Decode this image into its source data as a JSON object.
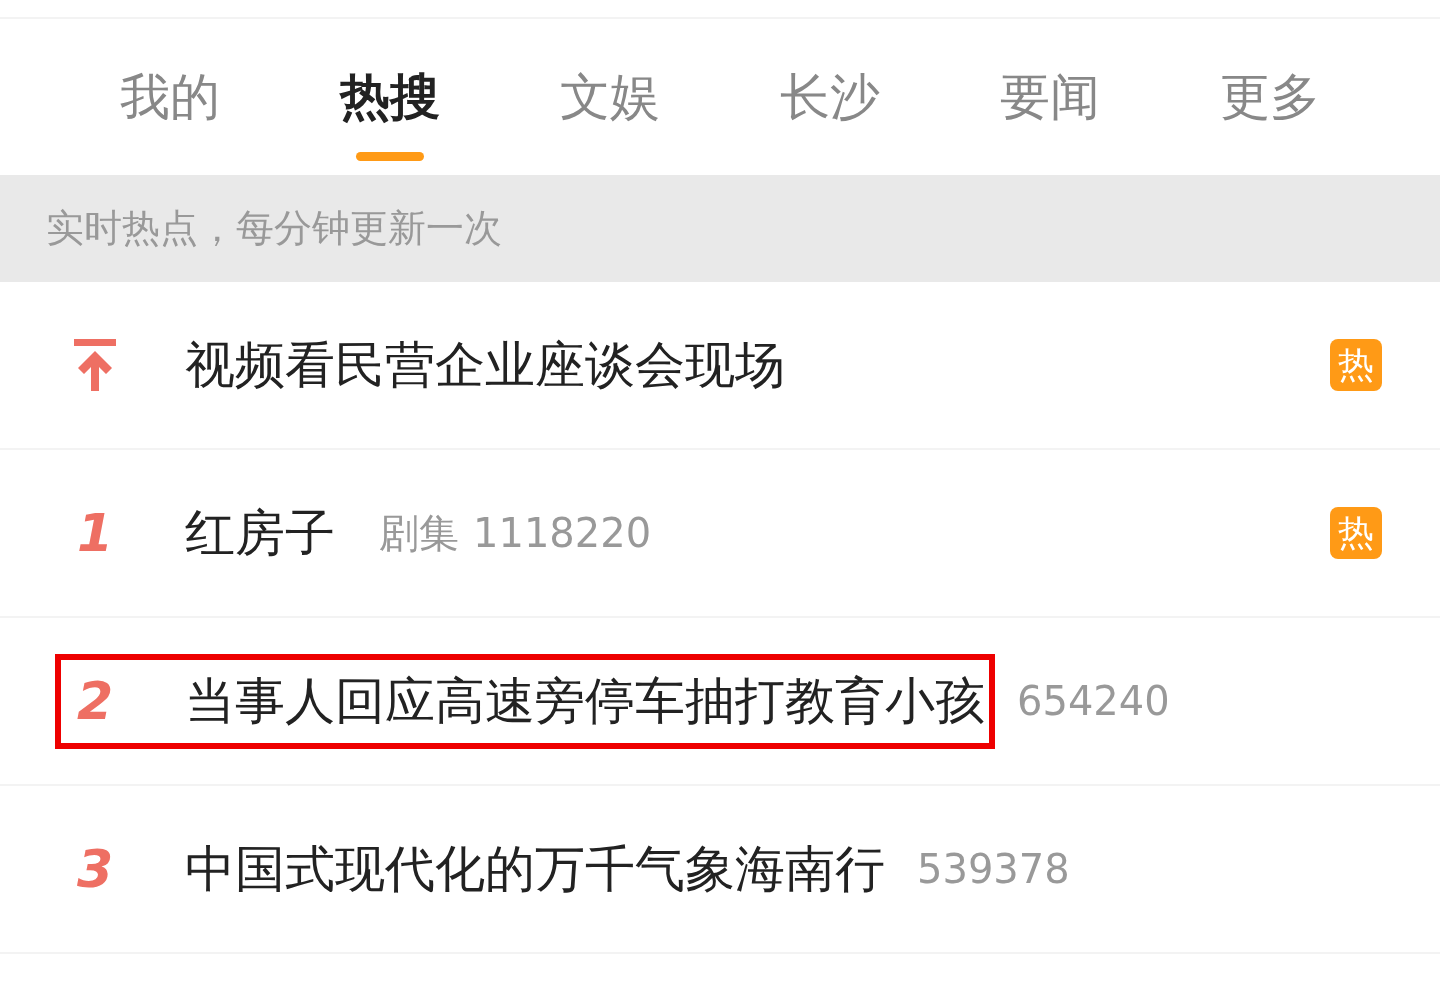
{
  "tabs": [
    {
      "label": "我的",
      "selected": false
    },
    {
      "label": "热搜",
      "selected": true
    },
    {
      "label": "文娱",
      "selected": false
    },
    {
      "label": "长沙",
      "selected": false
    },
    {
      "label": "要闻",
      "selected": false
    },
    {
      "label": "更多",
      "selected": false
    }
  ],
  "banner": "实时热点，每分钟更新一次",
  "rows": [
    {
      "kind": "pinned",
      "title": "视频看民营企业座谈会现场",
      "badge": "热",
      "highlighted": false
    },
    {
      "kind": "ranked",
      "rank": "1",
      "title": "红房子",
      "tag": "剧集",
      "count": "1118220",
      "badge": "热",
      "highlighted": false
    },
    {
      "kind": "ranked",
      "rank": "2",
      "title": "当事人回应高速旁停车抽打教育小孩",
      "count": "654240",
      "highlighted": true
    },
    {
      "kind": "ranked",
      "rank": "3",
      "title": "中国式现代化的万千气象海南行",
      "count": "539378",
      "highlighted": false
    }
  ]
}
